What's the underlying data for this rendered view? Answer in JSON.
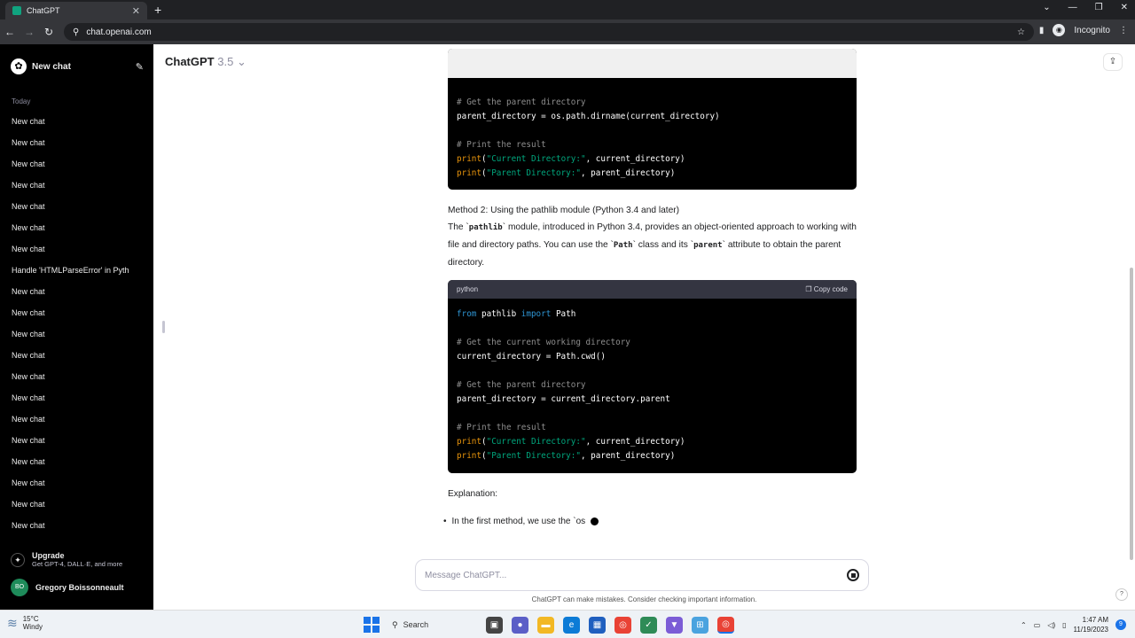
{
  "browser": {
    "tab_title": "ChatGPT",
    "url": "chat.openai.com",
    "mode": "Incognito"
  },
  "sidebar": {
    "new_chat": "New chat",
    "section": "Today",
    "items": [
      "New chat",
      "New chat",
      "New chat",
      "New chat",
      "New chat",
      "New chat",
      "New chat",
      "Handle 'HTMLParseError' in Pyth",
      "New chat",
      "New chat",
      "New chat",
      "New chat",
      "New chat",
      "New chat",
      "New chat",
      "New chat",
      "New chat",
      "New chat",
      "New chat",
      "New chat"
    ],
    "upgrade_title": "Upgrade",
    "upgrade_sub": "Get GPT-4, DALL·E, and more",
    "user_initials": "BO",
    "user_name": "Gregory Boissonneault"
  },
  "main": {
    "model_name": "ChatGPT",
    "model_version": "3.5",
    "code1": {
      "lines": [
        {
          "t": "cm",
          "v": "# Get the parent directory"
        },
        {
          "t": "plain",
          "v": "parent_directory = os.path.dirname(current_directory)"
        },
        {
          "t": "blank",
          "v": ""
        },
        {
          "t": "cm",
          "v": "# Print the result"
        },
        {
          "t": "print",
          "fn": "print",
          "str": "\"Current Directory:\"",
          "rest": ", current_directory)"
        },
        {
          "t": "print",
          "fn": "print",
          "str": "\"Parent Directory:\"",
          "rest": ", parent_directory)"
        }
      ]
    },
    "method2_heading": "Method 2: Using the pathlib module (Python 3.4 and later)",
    "method2_p": {
      "a": "The `",
      "code1": "pathlib",
      "b": "` module, introduced in Python 3.4, provides an object-oriented approach to working with file and directory paths. You can use the `",
      "code2": "Path",
      "c": "` class and its `",
      "code3": "parent",
      "d": "` attribute to obtain the parent directory."
    },
    "code2": {
      "lang": "python",
      "copy_label": "Copy code",
      "lines": [
        {
          "t": "import",
          "kw1": "from",
          "mod": " pathlib ",
          "kw2": "import",
          "rest": " Path"
        },
        {
          "t": "blank",
          "v": ""
        },
        {
          "t": "cm",
          "v": "# Get the current working directory"
        },
        {
          "t": "plain",
          "v": "current_directory = Path.cwd()"
        },
        {
          "t": "blank",
          "v": ""
        },
        {
          "t": "cm",
          "v": "# Get the parent directory"
        },
        {
          "t": "plain",
          "v": "parent_directory = current_directory.parent"
        },
        {
          "t": "blank",
          "v": ""
        },
        {
          "t": "cm",
          "v": "# Print the result"
        },
        {
          "t": "print",
          "fn": "print",
          "str": "\"Current Directory:\"",
          "rest": ", current_directory)"
        },
        {
          "t": "print",
          "fn": "print",
          "str": "\"Parent Directory:\"",
          "rest": ", parent_directory)"
        }
      ]
    },
    "explanation": "Explanation:",
    "bullet1": "In the first method, we use the `os",
    "composer_placeholder": "Message ChatGPT...",
    "disclaimer": "ChatGPT can make mistakes. Consider checking important information.",
    "help": "?"
  },
  "taskbar": {
    "temp": "15°C",
    "weather": "Windy",
    "search": "Search",
    "time": "1:47 AM",
    "date": "11/19/2023",
    "notifications": "9"
  }
}
